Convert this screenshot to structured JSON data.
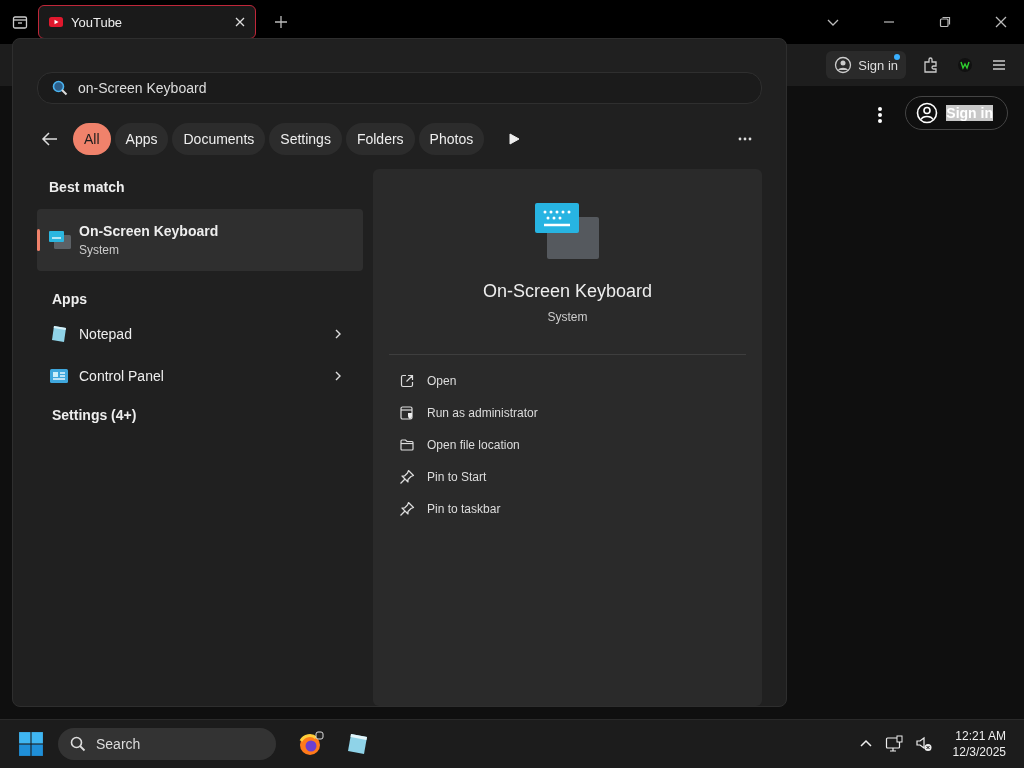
{
  "browser": {
    "tabs": [
      {
        "title": "YouTube",
        "selected": true
      }
    ],
    "toolbar": {
      "sign_in": "Sign in"
    },
    "page": {
      "sign_in": "Sign in"
    }
  },
  "search": {
    "query": "on-Screen Keyboard",
    "filters": [
      {
        "label": "All",
        "selected": true
      },
      {
        "label": "Apps",
        "selected": false
      },
      {
        "label": "Documents",
        "selected": false
      },
      {
        "label": "Settings",
        "selected": false
      },
      {
        "label": "Folders",
        "selected": false
      },
      {
        "label": "Photos",
        "selected": false
      }
    ],
    "best_match_heading": "Best match",
    "best_match": {
      "name": "On-Screen Keyboard",
      "type": "System",
      "selected": true
    },
    "apps_heading": "Apps",
    "apps": [
      {
        "name": "Notepad"
      },
      {
        "name": "Control Panel"
      }
    ],
    "settings_heading": "Settings (4+)",
    "detail": {
      "name": "On-Screen Keyboard",
      "type": "System",
      "actions": [
        {
          "label": "Open"
        },
        {
          "label": "Run as administrator"
        },
        {
          "label": "Open file location"
        },
        {
          "label": "Pin to Start"
        },
        {
          "label": "Pin to taskbar"
        }
      ]
    }
  },
  "taskbar": {
    "search_placeholder": "Search",
    "time": "12:21 AM",
    "date": "12/3/2025"
  }
}
